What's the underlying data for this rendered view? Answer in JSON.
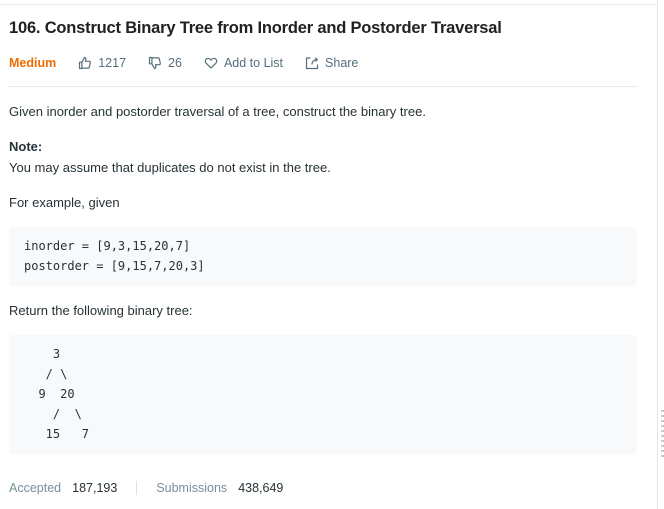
{
  "problem": {
    "title": "106. Construct Binary Tree from Inorder and Postorder Traversal",
    "difficulty": "Medium",
    "likes": "1217",
    "dislikes": "26",
    "add_to_list": "Add to List",
    "share": "Share"
  },
  "description": {
    "intro": "Given inorder and postorder traversal of a tree, construct the binary tree.",
    "note_heading": "Note:",
    "note_text": "You may assume that duplicates do not exist in the tree.",
    "example_intro": "For example, given",
    "example_code": "inorder = [9,3,15,20,7]\npostorder = [9,15,7,20,3]",
    "return_text": "Return the following binary tree:",
    "tree_code": "    3\n   / \\\n  9  20\n    /  \\\n   15   7"
  },
  "stats": {
    "accepted_label": "Accepted",
    "accepted_value": "187,193",
    "submissions_label": "Submissions",
    "submissions_value": "438,649"
  },
  "icons": {
    "like": "thumbs-up-icon",
    "dislike": "thumbs-down-icon",
    "add": "heart-icon",
    "share": "share-icon"
  },
  "colors": {
    "difficulty": "#ef6c00",
    "code_background": "#f7f9fa"
  }
}
